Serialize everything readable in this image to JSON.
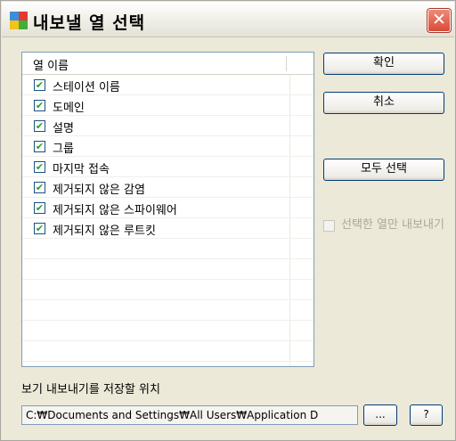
{
  "window": {
    "title": "내보낼 열 선택",
    "close_label": "✕"
  },
  "list": {
    "header": "열 이름",
    "items": [
      {
        "label": "스테이션 이름",
        "checked": true
      },
      {
        "label": "도메인",
        "checked": true
      },
      {
        "label": "설명",
        "checked": true
      },
      {
        "label": "그룹",
        "checked": true
      },
      {
        "label": "마지막 접속",
        "checked": true
      },
      {
        "label": "제거되지 않은 감염",
        "checked": true
      },
      {
        "label": "제거되지 않은 스파이웨어",
        "checked": true
      },
      {
        "label": "제거되지 않은 루트킷",
        "checked": true
      }
    ]
  },
  "buttons": {
    "ok": "확인",
    "cancel": "취소",
    "select_all": "모두 선택",
    "browse": "...",
    "help": "?"
  },
  "options": {
    "only_selected_label": "선택한 열만 내보내기",
    "only_selected_checked": false,
    "only_selected_enabled": false
  },
  "save": {
    "label": "보기 내보내기를 저장할 위치",
    "path": "C:₩Documents and Settings₩All Users₩Application D"
  },
  "colors": {
    "check_mark": "#21a121",
    "close_button": "#d94a36",
    "disabled_text": "#aca899"
  },
  "icons": {
    "app": "avg-logo-icon",
    "close": "close-icon",
    "checkbox": "checkbox-icon"
  }
}
